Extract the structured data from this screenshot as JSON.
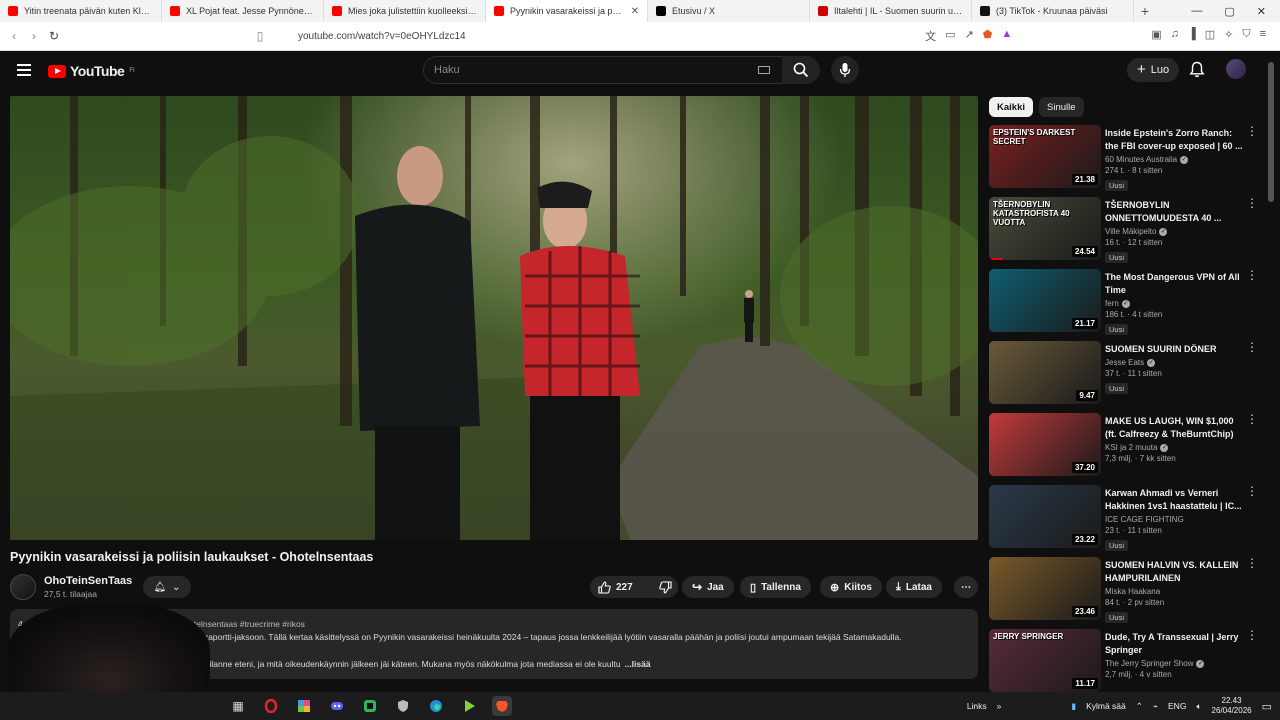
{
  "browser": {
    "tabs": [
      {
        "title": "Yitin treenata päivän kuten Klebo -",
        "fav_color": "#ff0000",
        "active": false
      },
      {
        "title": "XL Pojat feat. Jesse Pynnönen - You",
        "fav_color": "#ff0000",
        "active": false
      },
      {
        "title": "Mies joka julistettiin kuolleeksi – min",
        "fav_color": "#ff0000",
        "active": false
      },
      {
        "title": "Pyynikin vasarakeissi ja poliis",
        "fav_color": "#ff0000",
        "active": true
      },
      {
        "title": "Etusivu / X",
        "fav_color": "#000000",
        "active": false
      },
      {
        "title": "Iltalehti | IL - Suomen suurin uutispa",
        "fav_color": "#cc0000",
        "active": false
      },
      {
        "title": "(3) TikTok - Kruunaa päiväsi",
        "fav_color": "#111111",
        "active": false
      }
    ],
    "url": "youtube.com/watch?v=0eOHYLdzc14"
  },
  "header": {
    "logo_text": "YouTube",
    "logo_region": "FI",
    "search_placeholder": "Haku",
    "create_label": "Luo"
  },
  "video": {
    "title": "Pyynikin vasarakeissi ja poliisin laukaukset - Ohotelnsentaas",
    "channel_name": "OhoTeinSenTaas",
    "subscribers": "27,5 t. tilaajaa",
    "likes": "227",
    "share_label": "Jaa",
    "save_label": "Tallenna",
    "thanks_label": "Kiitos",
    "download_label": "Lataa"
  },
  "description": {
    "line1_prefix": "4.1",
    "tags": "#ohotelnsentaas #truecrime #rikos",
    "line2": "Rikosraportti-jaksoon. Tällä kertaa käsittelyssä on Pyynikin vasarakeissi heinäkuulta 2024 – tapaus jossa lenkkeilijää lyötiin vasaralla päähän ja poliisi joutui ampumaan tekijää Satamakadulla.",
    "line3": "miten tilanne eteni, ja mitä oikeudenkäynnin jälkeen jäi käteen. Mukana myös näkökulma jota mediassa ei ole kuultu",
    "more": "...lisää"
  },
  "sidebar": {
    "chips": [
      "Kaikki",
      "Sinulle"
    ],
    "items": [
      {
        "title": "Inside Epstein's Zorro Ranch: the FBI cover-up exposed | 60 ...",
        "channel": "60 Minutes Australia",
        "verified": true,
        "meta": "274 t. · 8 t sitten",
        "badge": "Uusi",
        "duration": "21.38",
        "thumb_text": "EPSTEIN'S DARKEST SECRET",
        "thumb_bg": "#7a1f1f"
      },
      {
        "title": "TŠERNOBYLIN ONNETTOMUUDESTA 40 ...",
        "channel": "Ville Mäkipelto",
        "verified": true,
        "meta": "16 t. · 12 t sitten",
        "badge": "Uusi",
        "duration": "24.54",
        "thumb_text": "TŠERNOBYLIN KATASTROFISTA 40 VUOTTA",
        "thumb_bg": "#4a4a3a"
      },
      {
        "title": "The Most Dangerous VPN of All Time",
        "channel": "fern",
        "verified": true,
        "meta": "186 t. · 4 t sitten",
        "badge": "Uusi",
        "duration": "21.17",
        "thumb_text": "",
        "thumb_bg": "#0f5e72"
      },
      {
        "title": "SUOMEN SUURIN DÖNER",
        "channel": "Jesse Eats",
        "verified": true,
        "meta": "37 t. · 11 t sitten",
        "badge": "Uusi",
        "duration": "9.47",
        "thumb_text": "",
        "thumb_bg": "#6a5a3a"
      },
      {
        "title": "MAKE US LAUGH, WIN $1,000 (ft. Calfreezy & TheBurntChip)",
        "channel": "KSI ja 2 muuta",
        "verified": true,
        "meta": "7,3 milj. · 7 kk sitten",
        "badge": "",
        "duration": "37.20",
        "thumb_text": "",
        "thumb_bg": "#c43a3a"
      },
      {
        "title": "Karwan Ahmadi vs Verneri Hakkinen 1vs1 haastattelu | IC...",
        "channel": "ICE CAGE FIGHTING",
        "verified": false,
        "meta": "23 t. · 11 t sitten",
        "badge": "Uusi",
        "duration": "23.22",
        "thumb_text": "",
        "thumb_bg": "#2a3a4a"
      },
      {
        "title": "SUOMEN HALVIN VS. KALLEIN HAMPURILAINEN",
        "channel": "Miska Haakana",
        "verified": false,
        "meta": "84 t. · 2 pv sitten",
        "badge": "Uusi",
        "duration": "23.46",
        "thumb_text": "",
        "thumb_bg": "#7a5a2a"
      },
      {
        "title": "Dude, Try A Transsexual | Jerry Springer",
        "channel": "The Jerry Springer Show",
        "verified": true,
        "meta": "2,7 milj. · 4 v sitten",
        "badge": "",
        "duration": "11.17",
        "thumb_text": "JERRY SPRINGER",
        "thumb_bg": "#5a2a3a"
      }
    ]
  },
  "taskbar": {
    "links_label": "Links",
    "weather": "Kylmä sää",
    "lang": "ENG",
    "time": "22.43",
    "date": "26/04/2026"
  }
}
